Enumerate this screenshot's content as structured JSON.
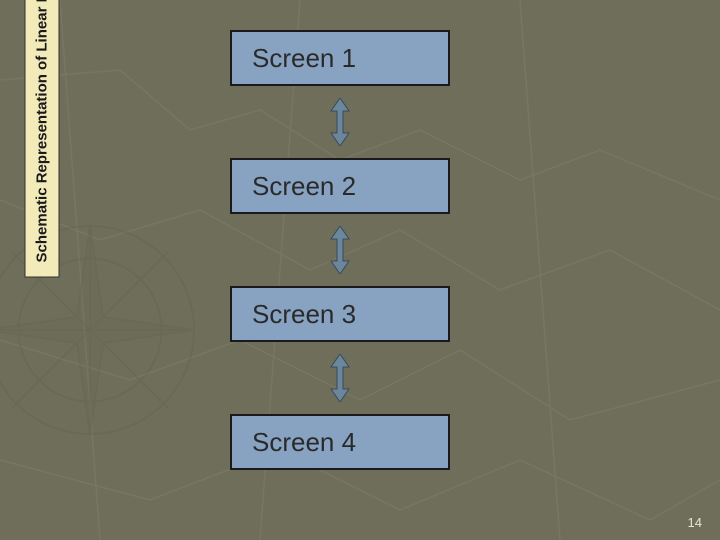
{
  "sidebar": {
    "label": "Schematic Representation of Linear Nav Map Structure"
  },
  "diagram": {
    "screens": [
      {
        "label": "Screen 1"
      },
      {
        "label": "Screen 2"
      },
      {
        "label": "Screen 3"
      },
      {
        "label": "Screen 4"
      }
    ]
  },
  "page_number": "14",
  "colors": {
    "box_fill": "#88a3c2",
    "box_border": "#1a1a1a",
    "sidebar_bg": "#f2eab9",
    "arrow": "#6a879e"
  }
}
